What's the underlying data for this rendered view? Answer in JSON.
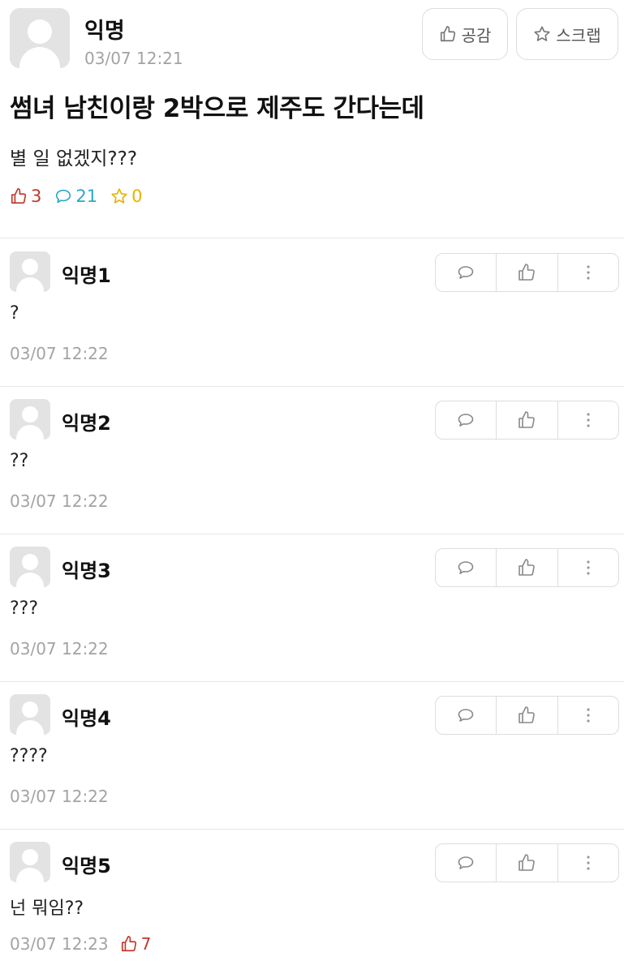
{
  "post": {
    "author": "익명",
    "date": "03/07 12:21",
    "like_button": "공감",
    "scrap_button": "스크랩",
    "title": "썸녀 남친이랑 2박으로 제주도 간다는데",
    "body": "별 일 없겠지???",
    "stats": {
      "likes": "3",
      "comments": "21",
      "scraps": "0"
    },
    "colors": {
      "likes": "#c0392b",
      "comments": "#2ba8c6",
      "scraps": "#e3b400"
    }
  },
  "comments": [
    {
      "author": "익명1",
      "text": "?",
      "date": "03/07 12:22"
    },
    {
      "author": "익명2",
      "text": "??",
      "date": "03/07 12:22"
    },
    {
      "author": "익명3",
      "text": "???",
      "date": "03/07 12:22"
    },
    {
      "author": "익명4",
      "text": "????",
      "date": "03/07 12:22"
    },
    {
      "author": "익명5",
      "text": "넌 뭐임??",
      "date": "03/07 12:23",
      "votes": "7"
    }
  ],
  "icons": {
    "comment_actions": [
      "reply-icon",
      "thumbs-up-icon",
      "more-vertical-icon"
    ],
    "header": [
      "thumbs-up-icon",
      "star-icon"
    ],
    "stats": [
      "thumbs-up-icon",
      "speech-bubble-icon",
      "star-icon"
    ]
  }
}
